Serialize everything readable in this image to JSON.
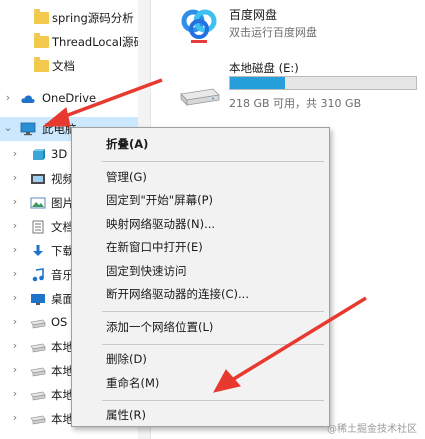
{
  "nav": {
    "folders": [
      {
        "label": "spring源码分析"
      },
      {
        "label": "ThreadLocal源码"
      },
      {
        "label": "文档"
      }
    ],
    "onedrive": "OneDrive",
    "this_pc": "此电脑",
    "children": [
      {
        "label": "3D",
        "icon": "3d-objects-icon"
      },
      {
        "label": "视频",
        "icon": "video-icon"
      },
      {
        "label": "图片",
        "icon": "picture-icon"
      },
      {
        "label": "文档",
        "icon": "document-icon"
      },
      {
        "label": "下载",
        "icon": "download-icon"
      },
      {
        "label": "音乐",
        "icon": "music-icon"
      },
      {
        "label": "桌面",
        "icon": "desktop-icon"
      },
      {
        "label": "OS",
        "icon": "drive-icon"
      },
      {
        "label": "本地",
        "icon": "drive-icon"
      },
      {
        "label": "本地",
        "icon": "drive-icon"
      },
      {
        "label": "本地",
        "icon": "drive-icon"
      },
      {
        "label": "本地磁盘",
        "icon": "drive-icon"
      }
    ]
  },
  "content": {
    "baidu_title": "百度网盘",
    "baidu_sub": "双击运行百度网盘",
    "drive_title": "本地磁盘 (E:)",
    "drive_space": "218 GB 可用，共 310 GB",
    "drive_used_fraction": 0.297
  },
  "menu": {
    "items": [
      {
        "label": "折叠(A)",
        "bold": true
      },
      {
        "sep": true
      },
      {
        "label": "管理(G)"
      },
      {
        "label": "固定到\"开始\"屏幕(P)"
      },
      {
        "label": "映射网络驱动器(N)..."
      },
      {
        "label": "在新窗口中打开(E)"
      },
      {
        "label": "固定到快速访问"
      },
      {
        "label": "断开网络驱动器的连接(C)..."
      },
      {
        "sep": true
      },
      {
        "label": "添加一个网络位置(L)"
      },
      {
        "sep": true
      },
      {
        "label": "删除(D)"
      },
      {
        "label": "重命名(M)"
      },
      {
        "sep": true
      },
      {
        "label": "属性(R)"
      }
    ]
  },
  "watermark": "@稀土掘金技术社区",
  "colors": {
    "selection": "#cce8ff",
    "arrow": "#e8392f",
    "accent": "#26a0da"
  }
}
